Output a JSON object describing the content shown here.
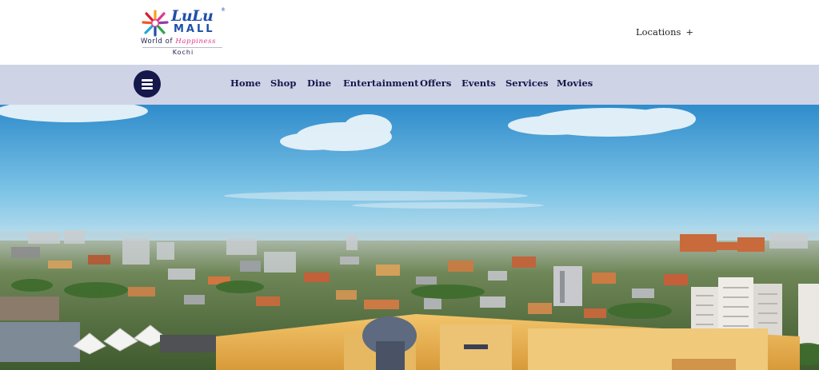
{
  "brand": {
    "name_script": "LuLu",
    "name_block": "MALL",
    "registered_mark": "®",
    "tagline_prefix": "World of ",
    "tagline_highlight": "Happiness",
    "city": "Kochi",
    "colors": {
      "primary": "#1f4fa8",
      "accent": "#e0398f",
      "navy": "#15184a"
    }
  },
  "header": {
    "locations_label": "Locations",
    "locations_icon": "+"
  },
  "navbar": {
    "menu_icon": "hamburger-icon",
    "background": "#cfd3e6",
    "items": [
      {
        "label": "Home"
      },
      {
        "label": "Shop"
      },
      {
        "label": "Dine"
      },
      {
        "label": "Entertainment"
      },
      {
        "label": "Offers"
      },
      {
        "label": "Events"
      },
      {
        "label": "Services"
      },
      {
        "label": "Movies"
      }
    ]
  },
  "hero": {
    "image": "aerial-city-skyline-photo",
    "sky_colors": [
      "#2f8ccb",
      "#7cc3e6",
      "#c7e3ee"
    ]
  }
}
